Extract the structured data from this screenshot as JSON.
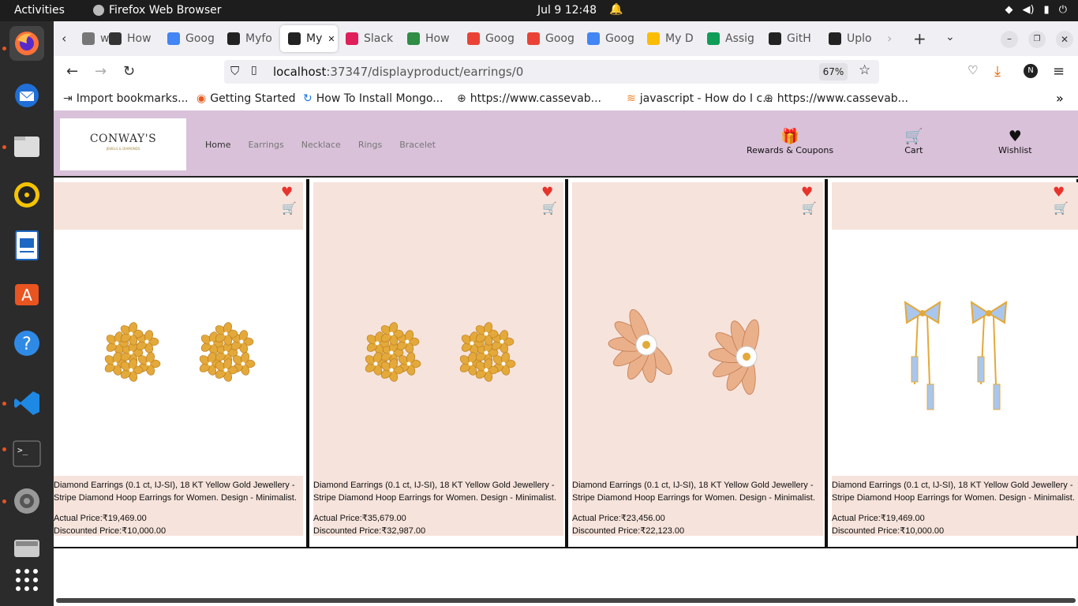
{
  "system": {
    "activities": "Activities",
    "app_name": "Firefox Web Browser",
    "clock": "Jul 9  12:48"
  },
  "tabs": [
    {
      "label": "w",
      "color": "#777"
    },
    {
      "label": "How",
      "color": "#333"
    },
    {
      "label": "Goog",
      "color": "#4285f4"
    },
    {
      "label": "Myfo",
      "color": "#222"
    },
    {
      "label": "My",
      "color": "#222"
    },
    {
      "label": "Slack",
      "color": "#e01e5a"
    },
    {
      "label": "How",
      "color": "#2f8d46"
    },
    {
      "label": "Goog",
      "color": "#ea4335"
    },
    {
      "label": "Goog",
      "color": "#ea4335"
    },
    {
      "label": "Goog",
      "color": "#4285f4"
    },
    {
      "label": "My D",
      "color": "#fbbc04"
    },
    {
      "label": "Assig",
      "color": "#0f9d58"
    },
    {
      "label": "GitH",
      "color": "#222"
    },
    {
      "label": "Uplo",
      "color": "#222"
    }
  ],
  "url": {
    "host": "localhost",
    "path": ":37347/displayproduct/earrings/0",
    "zoom": "67%",
    "profile_initial": "N"
  },
  "bookmarks": [
    "Import bookmarks...",
    "Getting Started",
    "How To Install Mongo...",
    "https://www.cassevab...",
    "javascript - How do I c...",
    "https://www.cassevab..."
  ],
  "site": {
    "logo_title": "CONWAY'S",
    "logo_sub": "JEWELS & DIAMONDS",
    "nav": [
      "Home",
      "Earrings",
      "Necklace",
      "Rings",
      "Bracelet"
    ],
    "rewards": "Rewards & Coupons",
    "cart": "Cart",
    "wishlist": "Wishlist"
  },
  "products": [
    {
      "description": "Diamond Earrings (0.1 ct, IJ-SI), 18 KT Yellow Gold Jewellery - Stripe Diamond Hoop Earrings for Women. Design - Minimalist.",
      "actual": "Actual Price:₹19,469.00",
      "discounted": "Discounted Price:₹10,000.00",
      "style": "flower"
    },
    {
      "description": "Diamond Earrings (0.1 ct, IJ-SI), 18 KT Yellow Gold Jewellery - Stripe Diamond Hoop Earrings for Women. Design - Minimalist.",
      "actual": "Actual Price:₹35,679.00",
      "discounted": "Discounted Price:₹32,987.00",
      "style": "flower"
    },
    {
      "description": "Diamond Earrings (0.1 ct, IJ-SI), 18 KT Yellow Gold Jewellery - Stripe Diamond Hoop Earrings for Women. Design - Minimalist.",
      "actual": "Actual Price:₹23,456.00",
      "discounted": "Discounted Price:₹22,123.00",
      "style": "leaf"
    },
    {
      "description": "Diamond Earrings (0.1 ct, IJ-SI), 18 KT Yellow Gold Jewellery - Stripe Diamond Hoop Earrings for Women. Design - Minimalist.",
      "actual": "Actual Price:₹19,469.00",
      "discounted": "Discounted Price:₹10,000.00",
      "style": "bow"
    }
  ],
  "colors": {
    "header_bg": "#d9c1d9",
    "card_band": "#f6e3db",
    "heart": "#e8332d",
    "gold": "#e3a93a"
  }
}
